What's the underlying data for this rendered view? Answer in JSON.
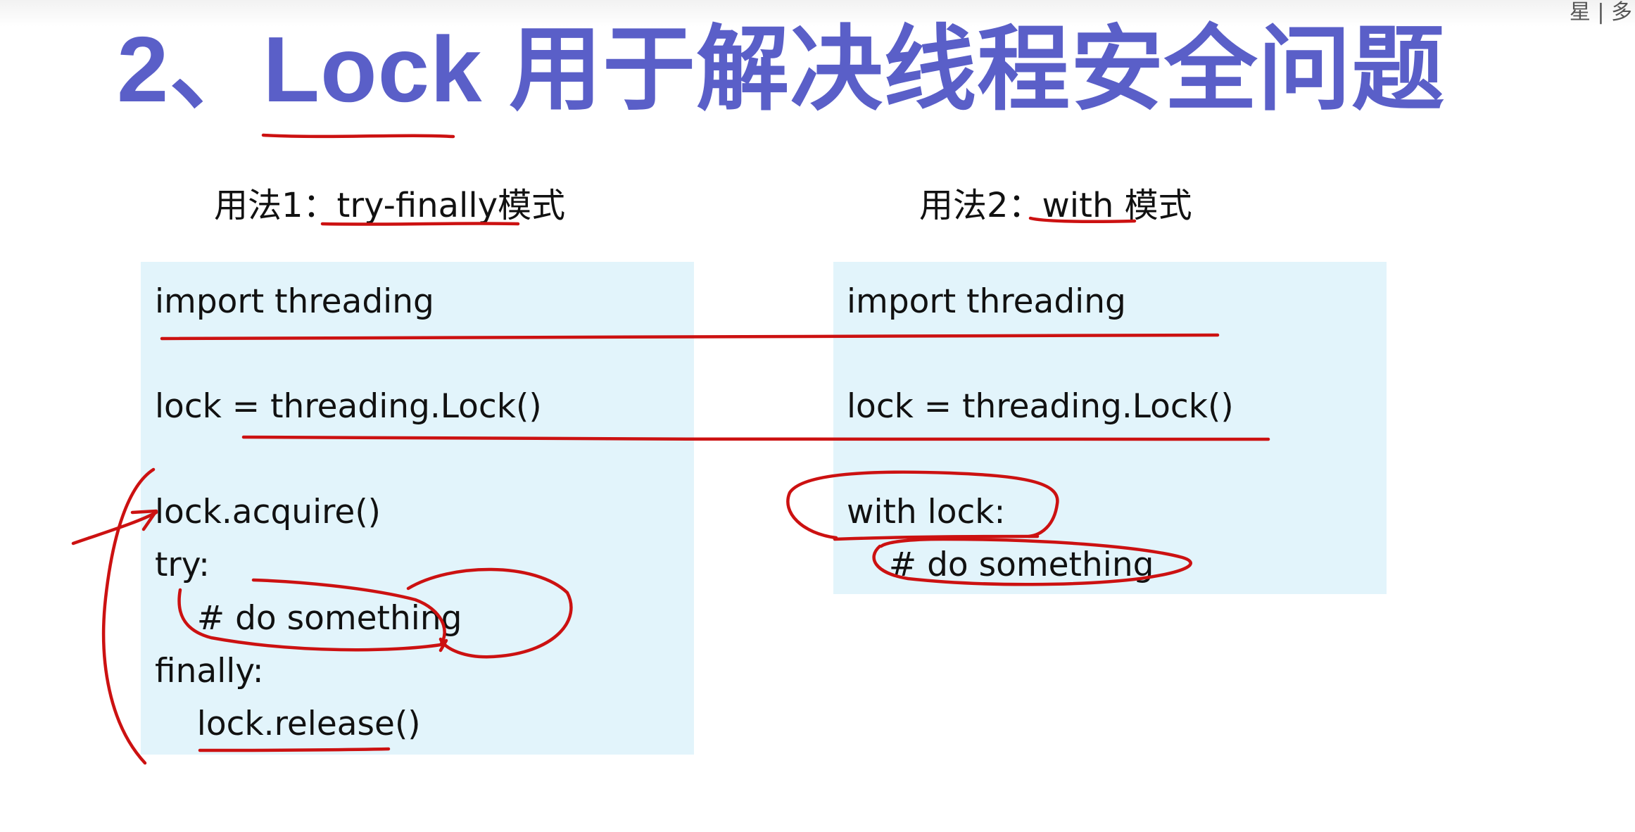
{
  "corner_text": "星 | 多",
  "title": "2、Lock 用于解决线程安全问题",
  "left_heading": "用法1：try-finally模式",
  "right_heading": "用法2：with 模式",
  "left_code": {
    "import": "import threading",
    "lock": "lock = threading.Lock()",
    "acquire": "lock.acquire()",
    "try": "try:",
    "do": "    # do something",
    "finally": "finally:",
    "release": "    lock.release()"
  },
  "right_code": {
    "import": "import threading",
    "lock": "lock = threading.Lock()",
    "with": "with lock:",
    "do": "    # do something"
  },
  "colors": {
    "title": "#5a5fc8",
    "code_background": "#e2f4fb",
    "annotation": "#cc1111"
  }
}
